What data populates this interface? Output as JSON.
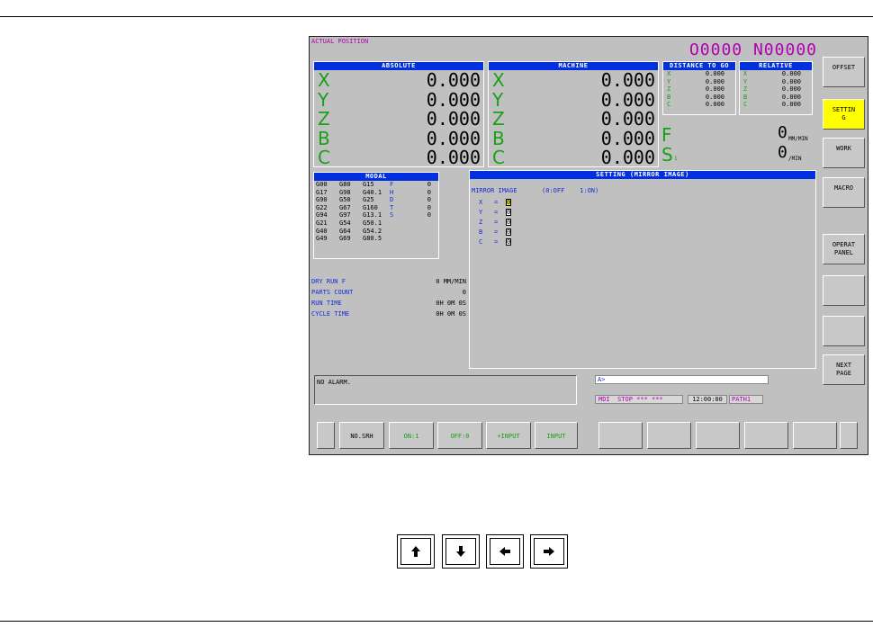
{
  "title": "ACTUAL POSITION",
  "program": "O0000 N00000",
  "absolute": {
    "header": "ABSOLUTE",
    "axes": [
      {
        "name": "X",
        "value": "0.000"
      },
      {
        "name": "Y",
        "value": "0.000"
      },
      {
        "name": "Z",
        "value": "0.000"
      },
      {
        "name": "B",
        "value": "0.000"
      },
      {
        "name": "C",
        "value": "0.000"
      }
    ]
  },
  "machine": {
    "header": "MACHINE",
    "axes": [
      {
        "name": "X",
        "value": "0.000"
      },
      {
        "name": "Y",
        "value": "0.000"
      },
      {
        "name": "Z",
        "value": "0.000"
      },
      {
        "name": "B",
        "value": "0.000"
      },
      {
        "name": "C",
        "value": "0.000"
      }
    ]
  },
  "distance": {
    "header": "DISTANCE TO GO",
    "axes": [
      {
        "name": "X",
        "value": "0.000"
      },
      {
        "name": "Y",
        "value": "0.000"
      },
      {
        "name": "Z",
        "value": "0.000"
      },
      {
        "name": "B",
        "value": "0.000"
      },
      {
        "name": "C",
        "value": "0.000"
      }
    ]
  },
  "relative": {
    "header": "RELATIVE",
    "axes": [
      {
        "name": "X",
        "value": "0.000"
      },
      {
        "name": "Y",
        "value": "0.000"
      },
      {
        "name": "Z",
        "value": "0.000"
      },
      {
        "name": "B",
        "value": "0.000"
      },
      {
        "name": "C",
        "value": "0.000"
      }
    ]
  },
  "feed": {
    "label": "F",
    "value": "0",
    "unit": "MM/MIN"
  },
  "spindle": {
    "label": "S",
    "sub": "1",
    "value": "0",
    "unit": "/MIN"
  },
  "modal": {
    "header": "MODAL",
    "rows": [
      [
        "G00",
        "G80",
        "G15",
        "F",
        "0"
      ],
      [
        "G17",
        "G98",
        "G40.1",
        "H",
        "0"
      ],
      [
        "G90",
        "G50",
        "G25",
        "D",
        "0"
      ],
      [
        "G22",
        "G67",
        "G160",
        "T",
        "0"
      ],
      [
        "G94",
        "G97",
        "G13.1",
        "S",
        "0"
      ],
      [
        "G21",
        "G54",
        "G50.1",
        "",
        ""
      ],
      [
        "G40",
        "G64",
        "G54.2",
        "",
        ""
      ],
      [
        "G49",
        "G69",
        "G80.5",
        "",
        ""
      ]
    ]
  },
  "status": [
    {
      "label": "DRY RUN F",
      "value": "0 MM/MIN"
    },
    {
      "label": "PARTS COUNT",
      "value": "0"
    },
    {
      "label": "RUN TIME",
      "value": "0H 0M 0S"
    },
    {
      "label": "CYCLE TIME",
      "value": "0H 0M 0S"
    }
  ],
  "setting": {
    "header": "SETTING (MIRROR IMAGE)",
    "label": "MIRROR IMAGE",
    "hint": "(0:OFF    1:ON)",
    "axes": [
      {
        "name": "X",
        "value": "0"
      },
      {
        "name": "Y",
        "value": "0"
      },
      {
        "name": "Z",
        "value": "0"
      },
      {
        "name": "B",
        "value": "0"
      },
      {
        "name": "C",
        "value": "0"
      }
    ]
  },
  "alarm": "NO ALARM.",
  "input_prompt": "A>",
  "status_bar": {
    "mode": "MDI  STOP *** ***",
    "time": "12:00:00",
    "path": "PATH1"
  },
  "right_softkeys": [
    {
      "label": "OFFSET"
    },
    {
      "label": "SETTIN\nG"
    },
    {
      "label": "WORK"
    },
    {
      "label": "MACRO"
    },
    {
      "label": "OPERAT\nPANEL"
    },
    {
      "label": ""
    },
    {
      "label": ""
    },
    {
      "label": "NEXT\nPAGE"
    }
  ],
  "bottom_softkeys": [
    "NO.SRH",
    "ON:1",
    "OFF:0",
    "+INPUT",
    "INPUT",
    "",
    "",
    "",
    "",
    "",
    ""
  ],
  "colors": {
    "accent_yellow": "#ffff00",
    "header_blue": "#0030e0",
    "axis_green": "#18a018",
    "program_magenta": "#b000b0"
  }
}
